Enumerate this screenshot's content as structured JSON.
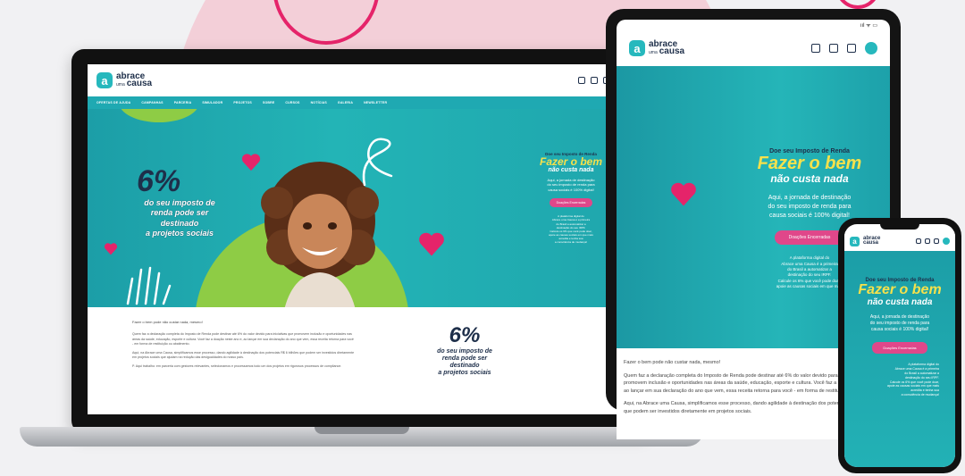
{
  "brand": {
    "logo_letter": "a",
    "name_line1": "abrace",
    "name_small": "uma",
    "name_line2": "causa",
    "accent": "#26b8bd",
    "pink": "#e0478a",
    "yellow": "#f6e14b",
    "navy": "#1e2f4a",
    "green": "#8ecc45"
  },
  "header_icons": [
    "home-icon",
    "copy-icon",
    "mail-icon",
    "avatar"
  ],
  "nav": [
    "Ofertas de ajuda",
    "Campanhas",
    "Parceria",
    "Simulador",
    "Projetos",
    "Sobre",
    "Cursos",
    "Notícias",
    "Galeria",
    "Newsletter"
  ],
  "hero": {
    "percent": "6%",
    "percent_text_1": "do seu imposto de",
    "percent_text_2": "renda pode ser",
    "percent_text_3": "destinado",
    "percent_text_4": "a projetos sociais",
    "pre_title": "Doe seu Imposto de Renda",
    "title": "Fazer o bem",
    "script": "não custa nada",
    "desc_1": "Aqui, a jornada de destinação",
    "desc_2": "do seu imposto de renda para",
    "desc_3": "causa sociais é 100% digital!",
    "button": "Doações Encerradas",
    "small_1": "A plataforma digital do",
    "small_2": "Abrace uma Causa é a primeira",
    "small_3": "do Brasil a automatizar a",
    "small_4": "destinação do seu IRPF.",
    "small_5": "Calcule os 6% que você pode doar,",
    "small_6": "apoie as causas sociais em que mais",
    "small_7": "acredita e tenha sua",
    "small_8": "a consciência de mudança!"
  },
  "lower": {
    "lead": "Fazer o bem pode não custar nada, mesmo!",
    "p1": "Quem faz a declaração completa do Imposto de Renda pode destinar até 6% do valor devido para iniciativas que promovem inclusão e oportunidades nas áreas da saúde, educação, esporte e cultura. Você faz a doação neste ano e, ao lançar em sua declaração do ano que vem, essa receita retorna para você - em forma de restituição ou abatimento.",
    "p2": "Aqui, na Abrace uma Causa, simplificamos esse processo, dando agilidade à destinação dos potenciais R$ 6 bilhões que podem ser investidos diretamente em projetos sociais que ajudam na redução das desigualdades do nosso país.",
    "p3": "P. Aqui trabalho: em parceria com gestores relevantes, selecionamos e processamos todo um dos projetos em rigorosos processos de compliance.",
    "percent": "6%",
    "percent_text_1": "do seu imposto de",
    "percent_text_2": "renda pode ser",
    "percent_text_3": "destinado",
    "percent_text_4": "a projetos sociais"
  },
  "tablet": {
    "status": "ııl ᯤ ▭",
    "lower_lead": "Fazer o bem pode não custar nada, mesmo!",
    "lower_p1": "Quem faz a declaração completa do Imposto de Renda pode destinar até 6% do valor devido para iniciativas que promovem inclusão e oportunidades nas áreas da saúde, educação, esporte e cultura. Você faz a doação neste ano e, ao lançar em sua declaração do ano que vem, essa receita retorna para você - em forma de restituição ou abatimento.",
    "lower_p2": "Aqui, na Abrace uma Causa, simplificamos esse processo, dando agilidade à destinação dos potenciais R$ 6 bilhões que podem ser investidos diretamente em projetos sociais."
  }
}
